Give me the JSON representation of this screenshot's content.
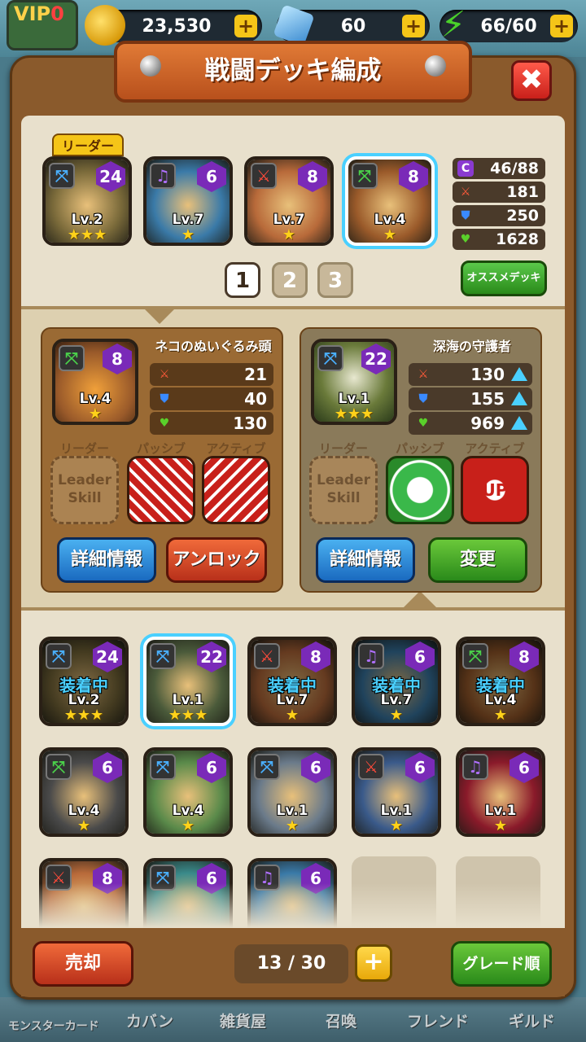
{
  "top": {
    "vip": {
      "label": "VIP",
      "level": "0"
    },
    "coins": "23,530",
    "gems": "60",
    "stamina": "66/60"
  },
  "nav": [
    "モンスターカード",
    "カバン",
    "雑貨屋",
    "召喚",
    "フレンド",
    "ギルド"
  ],
  "title": "戦闘デッキ編成",
  "close_label": "✖",
  "leader_tab": "リーダー",
  "deck": [
    {
      "cost": "24",
      "level": "Lv.2",
      "stars": "★★★",
      "element": "blue",
      "color": "#7a6a3a"
    },
    {
      "cost": "6",
      "level": "Lv.7",
      "stars": "★",
      "element": "purple",
      "color": "#3a7aa8"
    },
    {
      "cost": "8",
      "level": "Lv.7",
      "stars": "★",
      "element": "red",
      "color": "#b86a3a"
    },
    {
      "cost": "8",
      "level": "Lv.4",
      "stars": "★",
      "element": "green",
      "color": "#9a5a2a"
    }
  ],
  "deck_stats": {
    "cost": "46/88",
    "attack": "181",
    "defense": "250",
    "hp": "1628"
  },
  "pages": [
    "1",
    "2",
    "3"
  ],
  "recommend_label": "オススメデッキ",
  "detail_left": {
    "name": "ネコのぬいぐるみ頭",
    "cost": "8",
    "level": "Lv.4",
    "stars": "★",
    "attack": "21",
    "defense": "40",
    "hp": "130",
    "labels": {
      "leader": "リーダー",
      "passive": "パッシブ",
      "active": "アクティブ"
    },
    "leader_skill": "Leader Skill",
    "btn_info": "詳細情報",
    "btn_action": "アンロック"
  },
  "detail_right": {
    "name": "深海の守護者",
    "cost": "22",
    "level": "Lv.1",
    "stars": "★★★",
    "attack": "130",
    "defense": "155",
    "hp": "969",
    "labels": {
      "leader": "リーダー",
      "passive": "パッシブ",
      "active": "アクティブ"
    },
    "leader_skill": "Leader Skill",
    "active_text": "UP",
    "btn_info": "詳細情報",
    "btn_action": "変更"
  },
  "inventory": [
    {
      "cost": "24",
      "level": "Lv.2",
      "stars": "★★★",
      "equipped": "装着中",
      "element": "blue",
      "color": "#7a6a3a"
    },
    {
      "cost": "22",
      "level": "Lv.1",
      "stars": "★★★",
      "equipped": "",
      "element": "blue",
      "color": "#4a5a3a"
    },
    {
      "cost": "8",
      "level": "Lv.7",
      "stars": "★",
      "equipped": "装着中",
      "element": "red",
      "color": "#b86a3a"
    },
    {
      "cost": "6",
      "level": "Lv.7",
      "stars": "★",
      "equipped": "装着中",
      "element": "purple",
      "color": "#3a7aa8"
    },
    {
      "cost": "8",
      "level": "Lv.4",
      "stars": "★",
      "equipped": "装着中",
      "element": "green",
      "color": "#9a5a2a"
    },
    {
      "cost": "6",
      "level": "Lv.4",
      "stars": "★",
      "equipped": "",
      "element": "green",
      "color": "#4a4a4a"
    },
    {
      "cost": "6",
      "level": "Lv.4",
      "stars": "★",
      "equipped": "",
      "element": "blue",
      "color": "#5a8a4a"
    },
    {
      "cost": "6",
      "level": "Lv.1",
      "stars": "★",
      "equipped": "",
      "element": "blue",
      "color": "#6a7a8a"
    },
    {
      "cost": "6",
      "level": "Lv.1",
      "stars": "★",
      "equipped": "",
      "element": "red",
      "color": "#3a5a8a"
    },
    {
      "cost": "6",
      "level": "Lv.1",
      "stars": "★",
      "equipped": "",
      "element": "purple",
      "color": "#8a1a2a"
    },
    {
      "cost": "8",
      "level": "",
      "stars": "",
      "equipped": "",
      "element": "red",
      "color": "#b86a3a"
    },
    {
      "cost": "6",
      "level": "",
      "stars": "",
      "equipped": "",
      "element": "blue",
      "color": "#3a8a8a"
    },
    {
      "cost": "6",
      "level": "",
      "stars": "",
      "equipped": "",
      "element": "purple",
      "color": "#3a7aa8"
    }
  ],
  "sell_label": "売却",
  "count": "13 / 30",
  "add_label": "+",
  "sort_label": "グレード順"
}
